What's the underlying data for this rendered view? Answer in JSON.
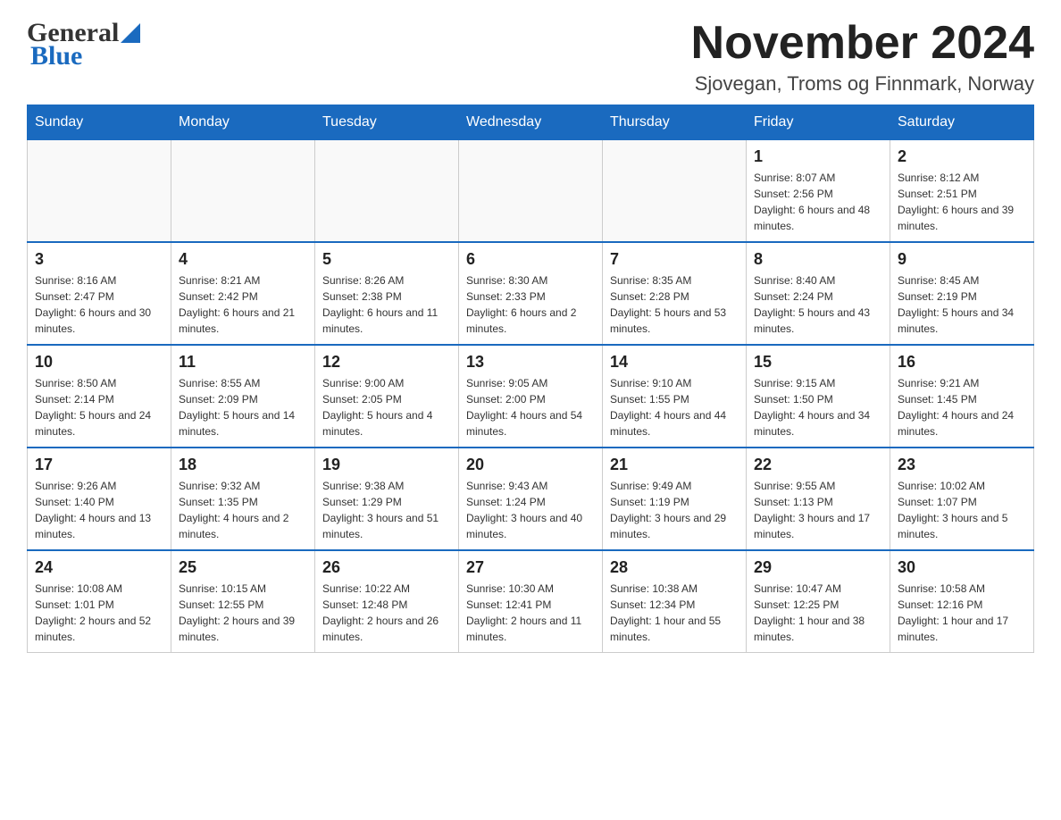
{
  "header": {
    "logo_general": "General",
    "logo_blue": "Blue",
    "month_title": "November 2024",
    "location": "Sjovegan, Troms og Finnmark, Norway"
  },
  "days_of_week": [
    "Sunday",
    "Monday",
    "Tuesday",
    "Wednesday",
    "Thursday",
    "Friday",
    "Saturday"
  ],
  "weeks": [
    [
      {
        "day": "",
        "info": ""
      },
      {
        "day": "",
        "info": ""
      },
      {
        "day": "",
        "info": ""
      },
      {
        "day": "",
        "info": ""
      },
      {
        "day": "",
        "info": ""
      },
      {
        "day": "1",
        "info": "Sunrise: 8:07 AM\nSunset: 2:56 PM\nDaylight: 6 hours and 48 minutes."
      },
      {
        "day": "2",
        "info": "Sunrise: 8:12 AM\nSunset: 2:51 PM\nDaylight: 6 hours and 39 minutes."
      }
    ],
    [
      {
        "day": "3",
        "info": "Sunrise: 8:16 AM\nSunset: 2:47 PM\nDaylight: 6 hours and 30 minutes."
      },
      {
        "day": "4",
        "info": "Sunrise: 8:21 AM\nSunset: 2:42 PM\nDaylight: 6 hours and 21 minutes."
      },
      {
        "day": "5",
        "info": "Sunrise: 8:26 AM\nSunset: 2:38 PM\nDaylight: 6 hours and 11 minutes."
      },
      {
        "day": "6",
        "info": "Sunrise: 8:30 AM\nSunset: 2:33 PM\nDaylight: 6 hours and 2 minutes."
      },
      {
        "day": "7",
        "info": "Sunrise: 8:35 AM\nSunset: 2:28 PM\nDaylight: 5 hours and 53 minutes."
      },
      {
        "day": "8",
        "info": "Sunrise: 8:40 AM\nSunset: 2:24 PM\nDaylight: 5 hours and 43 minutes."
      },
      {
        "day": "9",
        "info": "Sunrise: 8:45 AM\nSunset: 2:19 PM\nDaylight: 5 hours and 34 minutes."
      }
    ],
    [
      {
        "day": "10",
        "info": "Sunrise: 8:50 AM\nSunset: 2:14 PM\nDaylight: 5 hours and 24 minutes."
      },
      {
        "day": "11",
        "info": "Sunrise: 8:55 AM\nSunset: 2:09 PM\nDaylight: 5 hours and 14 minutes."
      },
      {
        "day": "12",
        "info": "Sunrise: 9:00 AM\nSunset: 2:05 PM\nDaylight: 5 hours and 4 minutes."
      },
      {
        "day": "13",
        "info": "Sunrise: 9:05 AM\nSunset: 2:00 PM\nDaylight: 4 hours and 54 minutes."
      },
      {
        "day": "14",
        "info": "Sunrise: 9:10 AM\nSunset: 1:55 PM\nDaylight: 4 hours and 44 minutes."
      },
      {
        "day": "15",
        "info": "Sunrise: 9:15 AM\nSunset: 1:50 PM\nDaylight: 4 hours and 34 minutes."
      },
      {
        "day": "16",
        "info": "Sunrise: 9:21 AM\nSunset: 1:45 PM\nDaylight: 4 hours and 24 minutes."
      }
    ],
    [
      {
        "day": "17",
        "info": "Sunrise: 9:26 AM\nSunset: 1:40 PM\nDaylight: 4 hours and 13 minutes."
      },
      {
        "day": "18",
        "info": "Sunrise: 9:32 AM\nSunset: 1:35 PM\nDaylight: 4 hours and 2 minutes."
      },
      {
        "day": "19",
        "info": "Sunrise: 9:38 AM\nSunset: 1:29 PM\nDaylight: 3 hours and 51 minutes."
      },
      {
        "day": "20",
        "info": "Sunrise: 9:43 AM\nSunset: 1:24 PM\nDaylight: 3 hours and 40 minutes."
      },
      {
        "day": "21",
        "info": "Sunrise: 9:49 AM\nSunset: 1:19 PM\nDaylight: 3 hours and 29 minutes."
      },
      {
        "day": "22",
        "info": "Sunrise: 9:55 AM\nSunset: 1:13 PM\nDaylight: 3 hours and 17 minutes."
      },
      {
        "day": "23",
        "info": "Sunrise: 10:02 AM\nSunset: 1:07 PM\nDaylight: 3 hours and 5 minutes."
      }
    ],
    [
      {
        "day": "24",
        "info": "Sunrise: 10:08 AM\nSunset: 1:01 PM\nDaylight: 2 hours and 52 minutes."
      },
      {
        "day": "25",
        "info": "Sunrise: 10:15 AM\nSunset: 12:55 PM\nDaylight: 2 hours and 39 minutes."
      },
      {
        "day": "26",
        "info": "Sunrise: 10:22 AM\nSunset: 12:48 PM\nDaylight: 2 hours and 26 minutes."
      },
      {
        "day": "27",
        "info": "Sunrise: 10:30 AM\nSunset: 12:41 PM\nDaylight: 2 hours and 11 minutes."
      },
      {
        "day": "28",
        "info": "Sunrise: 10:38 AM\nSunset: 12:34 PM\nDaylight: 1 hour and 55 minutes."
      },
      {
        "day": "29",
        "info": "Sunrise: 10:47 AM\nSunset: 12:25 PM\nDaylight: 1 hour and 38 minutes."
      },
      {
        "day": "30",
        "info": "Sunrise: 10:58 AM\nSunset: 12:16 PM\nDaylight: 1 hour and 17 minutes."
      }
    ]
  ]
}
